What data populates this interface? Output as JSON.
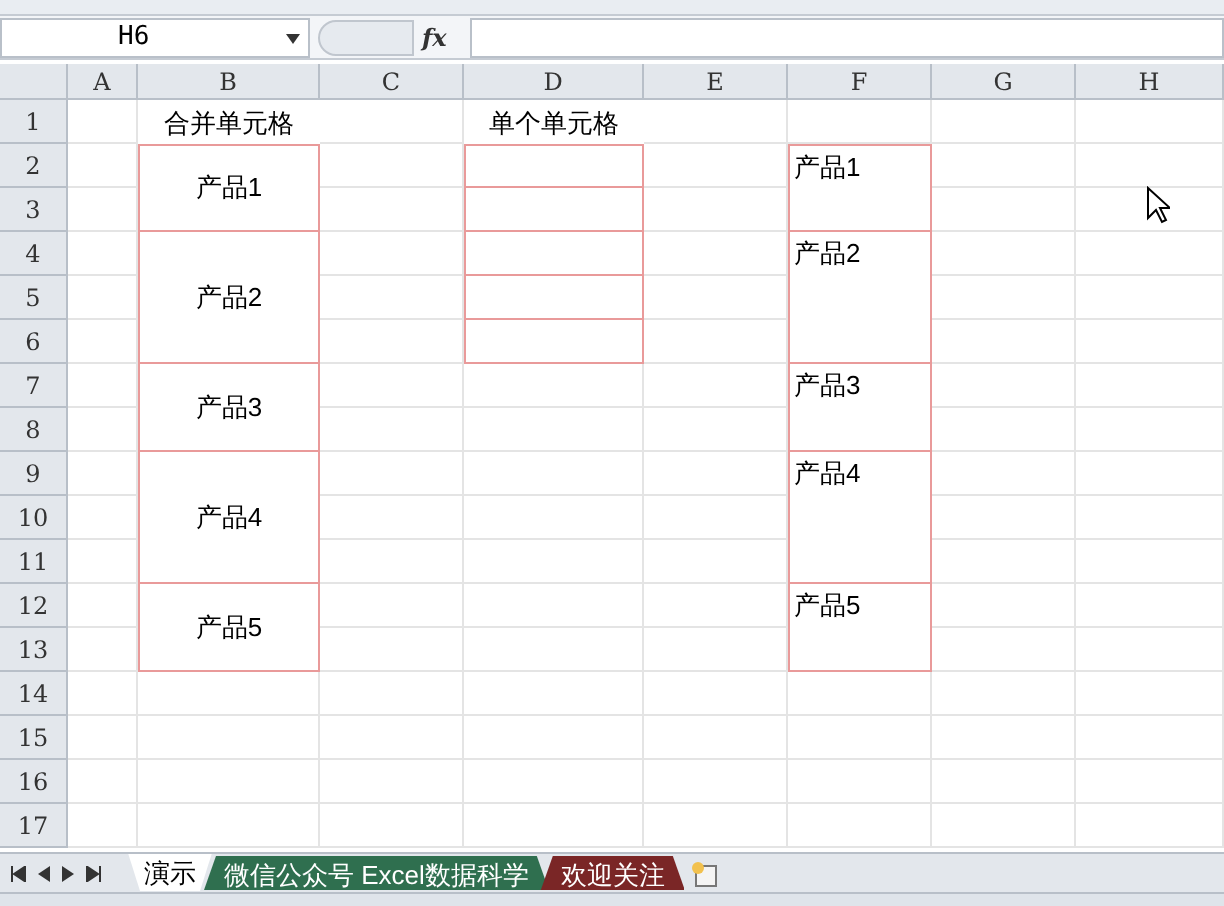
{
  "name_box": {
    "value": "H6"
  },
  "formula_bar": {
    "fx_label": "fx"
  },
  "columns": [
    "A",
    "B",
    "C",
    "D",
    "E",
    "F",
    "G",
    "H"
  ],
  "rows": [
    "1",
    "2",
    "3",
    "4",
    "5",
    "6",
    "7",
    "8",
    "9",
    "10",
    "11",
    "12",
    "13",
    "14",
    "15",
    "16",
    "17"
  ],
  "headings": [
    "合并单元格",
    "单个单元格"
  ],
  "merged_cells": [
    "产品1",
    "产品2",
    "产品3",
    "产品4",
    "产品5"
  ],
  "copied_cells": [
    "产品1",
    "产品2",
    "产品3",
    "产品4",
    "产品5"
  ],
  "sheet_tabs": [
    {
      "label": "演示",
      "selected": true,
      "color": "#ffffff"
    },
    {
      "label": "微信公众号 Excel数据科学",
      "selected": false,
      "color": "#2f6f4f"
    },
    {
      "label": "欢迎关注",
      "selected": false,
      "color": "#7a2626"
    }
  ]
}
